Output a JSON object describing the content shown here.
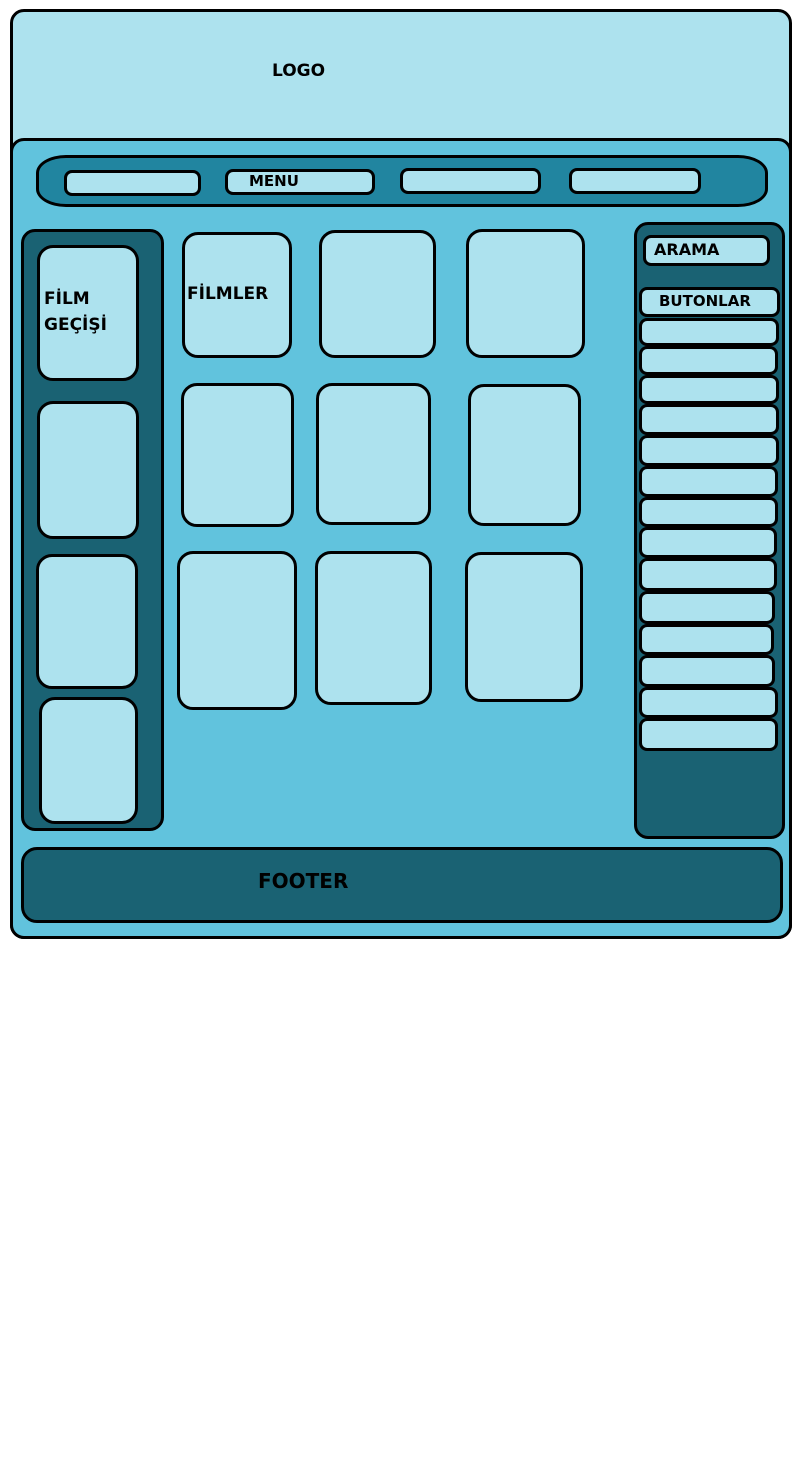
{
  "header": {
    "logo_label": "LOGO"
  },
  "menu": {
    "label": "MENU",
    "items": [
      "",
      "MENU",
      "",
      ""
    ]
  },
  "film_slider": {
    "label_line1": "FİLM",
    "label_line2": "GEÇİŞİ"
  },
  "movies": {
    "label": "FİLMLER"
  },
  "sidebar": {
    "search_label": "ARAMA",
    "buttons_label": "BUTONLAR"
  },
  "footer": {
    "label": "FOOTER"
  },
  "colors": {
    "page_background": "#ffffff",
    "header_background": "#ade2ee",
    "main_background": "#61c3dd",
    "menu_bar": "#2185a0",
    "dark_panel": "#1a6273",
    "placeholder_box": "#ade2ee",
    "border": "#000000"
  }
}
